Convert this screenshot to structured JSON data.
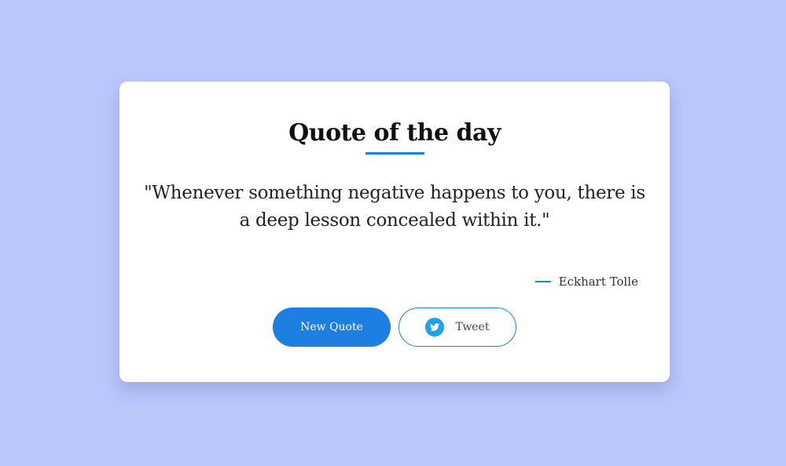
{
  "card": {
    "title": "Quote of the day",
    "quote": "\"Whenever something negative happens to you, there is a deep lesson concealed within it.\"",
    "author": "Eckhart Tolle"
  },
  "buttons": {
    "new_quote_label": "New Quote",
    "tweet_label": "Tweet",
    "tweet_icon": "twitter-icon"
  },
  "colors": {
    "background": "#bbc6fb",
    "accent": "#1e7fe3",
    "card": "#ffffff"
  }
}
